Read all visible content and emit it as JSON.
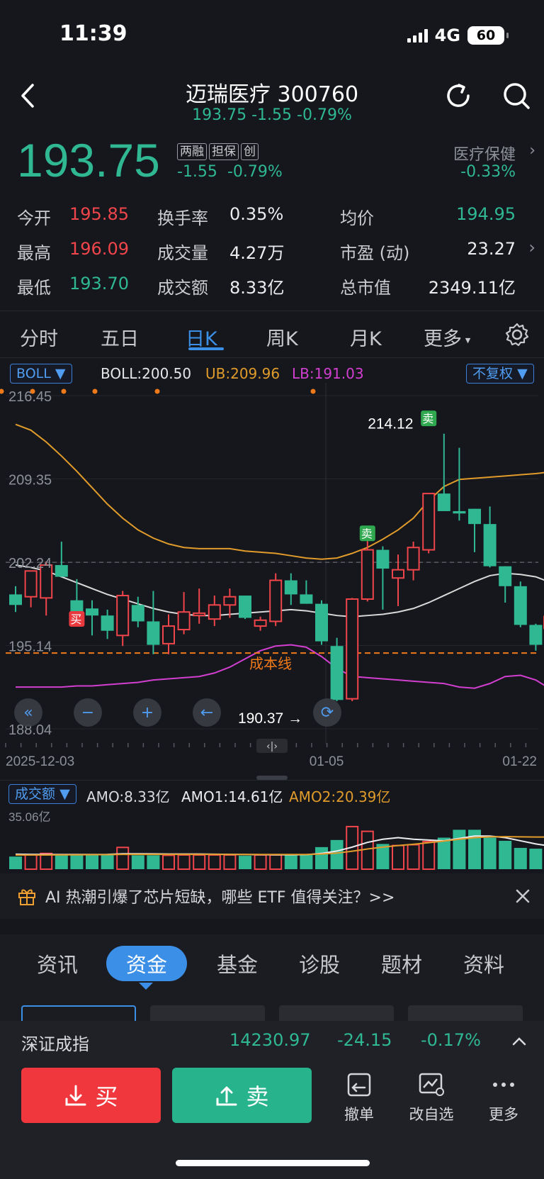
{
  "status": {
    "time": "11:39",
    "network": "4G",
    "battery": "60"
  },
  "header": {
    "title": "迈瑞医疗 300760",
    "subtitle": "193.75 -1.55 -0.79%"
  },
  "quote": {
    "price": "193.75",
    "tags": [
      "两融",
      "担保",
      "创"
    ],
    "change": "-1.55",
    "change_pct": "-0.79%",
    "sector_name": "医疗保健",
    "sector_change": "-0.33%"
  },
  "stats": {
    "open_label": "今开",
    "open": "195.85",
    "turnover_label": "换手率",
    "turnover": "0.35%",
    "avg_label": "均价",
    "avg": "194.95",
    "high_label": "最高",
    "high": "196.09",
    "volume_label": "成交量",
    "volume": "4.27万",
    "pe_label": "市盈 (动)",
    "pe": "23.27",
    "low_label": "最低",
    "low": "193.70",
    "amount_label": "成交额",
    "amount": "8.33亿",
    "mcap_label": "总市值",
    "mcap": "2349.11亿"
  },
  "period_tabs": [
    "分时",
    "五日",
    "日K",
    "周K",
    "月K",
    "更多"
  ],
  "active_period": "日K",
  "indicator": {
    "name": "BOLL",
    "boll": "BOLL:200.50",
    "ub": "UB:209.96",
    "lb": "LB:191.03",
    "adjust": "不复权"
  },
  "chart_data": {
    "type": "candlestick",
    "y_ticks": [
      "216.45",
      "209.35",
      "202.24",
      "195.14",
      "188.04"
    ],
    "ylim": [
      188.04,
      216.45
    ],
    "x_labels": [
      "2025-12-03",
      "01-05",
      "01-22"
    ],
    "annotations": {
      "high_label": "214.12",
      "low_label": "190.37",
      "cost_line_label": "成本线",
      "cost_line_value": 194.5,
      "sell_marker": "卖",
      "buy_marker": "买"
    },
    "candles": [
      {
        "o": 199.5,
        "h": 200.2,
        "l": 198.0,
        "c": 198.6
      },
      {
        "o": 199.3,
        "h": 201.3,
        "l": 198.4,
        "c": 201.5
      },
      {
        "o": 199.2,
        "h": 202.3,
        "l": 197.7,
        "c": 202.0
      },
      {
        "o": 202.0,
        "h": 204.0,
        "l": 201.1,
        "c": 201.0
      },
      {
        "o": 199.0,
        "h": 200.8,
        "l": 197.7,
        "c": 197.8
      },
      {
        "o": 198.3,
        "h": 199.0,
        "l": 196.0,
        "c": 197.7
      },
      {
        "o": 197.7,
        "h": 198.2,
        "l": 195.7,
        "c": 196.4
      },
      {
        "o": 196.0,
        "h": 199.8,
        "l": 195.1,
        "c": 199.4
      },
      {
        "o": 198.6,
        "h": 199.3,
        "l": 196.7,
        "c": 197.2
      },
      {
        "o": 197.2,
        "h": 199.8,
        "l": 194.4,
        "c": 195.2
      },
      {
        "o": 195.3,
        "h": 197.8,
        "l": 194.4,
        "c": 196.8
      },
      {
        "o": 196.5,
        "h": 199.7,
        "l": 196.1,
        "c": 198.0
      },
      {
        "o": 197.7,
        "h": 200.0,
        "l": 197.0,
        "c": 197.9
      },
      {
        "o": 197.4,
        "h": 199.4,
        "l": 196.8,
        "c": 198.6
      },
      {
        "o": 198.6,
        "h": 200.0,
        "l": 197.5,
        "c": 199.3
      },
      {
        "o": 199.4,
        "h": 199.4,
        "l": 197.4,
        "c": 197.5
      },
      {
        "o": 196.8,
        "h": 197.6,
        "l": 196.4,
        "c": 197.3
      },
      {
        "o": 197.2,
        "h": 201.3,
        "l": 196.8,
        "c": 200.7
      },
      {
        "o": 200.7,
        "h": 201.3,
        "l": 198.6,
        "c": 199.5
      },
      {
        "o": 199.5,
        "h": 200.7,
        "l": 198.7,
        "c": 198.7
      },
      {
        "o": 198.7,
        "h": 199.0,
        "l": 195.2,
        "c": 195.5
      },
      {
        "o": 195.1,
        "h": 195.8,
        "l": 190.4,
        "c": 190.5
      },
      {
        "o": 190.6,
        "h": 199.2,
        "l": 190.4,
        "c": 199.1
      },
      {
        "o": 199.1,
        "h": 204.3,
        "l": 198.9,
        "c": 203.3
      },
      {
        "o": 203.3,
        "h": 203.6,
        "l": 198.2,
        "c": 201.7
      },
      {
        "o": 200.9,
        "h": 202.9,
        "l": 198.5,
        "c": 201.6
      },
      {
        "o": 201.6,
        "h": 204.0,
        "l": 200.7,
        "c": 203.5
      },
      {
        "o": 203.3,
        "h": 208.0,
        "l": 203.0,
        "c": 208.1
      },
      {
        "o": 208.1,
        "h": 213.2,
        "l": 206.7,
        "c": 206.6
      },
      {
        "o": 206.6,
        "h": 212.0,
        "l": 205.8,
        "c": 206.4
      },
      {
        "o": 206.8,
        "h": 206.8,
        "l": 203.1,
        "c": 205.5
      },
      {
        "o": 205.5,
        "h": 207.0,
        "l": 201.8,
        "c": 201.9
      },
      {
        "o": 201.9,
        "h": 201.9,
        "l": 198.8,
        "c": 200.2
      },
      {
        "o": 200.2,
        "h": 200.6,
        "l": 196.7,
        "c": 196.9
      },
      {
        "o": 196.9,
        "h": 197.0,
        "l": 194.7,
        "c": 195.2
      },
      {
        "o": 195.2,
        "h": 195.7,
        "l": 193.7,
        "c": 193.8
      }
    ],
    "boll_ub": [
      214.0,
      213.5,
      212.5,
      211.3,
      210.0,
      208.6,
      207.2,
      206.0,
      205.0,
      204.3,
      203.8,
      203.5,
      203.4,
      203.4,
      203.4,
      203.2,
      203.1,
      203.0,
      202.8,
      202.6,
      202.5,
      202.6,
      203.0,
      203.5,
      204.2,
      205.0,
      206.0,
      207.5,
      208.7,
      209.3,
      209.4,
      209.5,
      209.6,
      209.7,
      209.8,
      209.96
    ],
    "boll_mid": [
      202.0,
      201.8,
      201.5,
      201.0,
      200.5,
      200.0,
      199.5,
      199.1,
      198.7,
      198.3,
      198.0,
      197.8,
      197.7,
      197.7,
      197.8,
      197.9,
      198.0,
      198.1,
      198.2,
      198.1,
      197.9,
      197.7,
      197.6,
      197.7,
      197.8,
      198.0,
      198.3,
      198.8,
      199.4,
      200.0,
      200.6,
      201.1,
      201.3,
      201.2,
      201.0,
      200.5
    ],
    "boll_lb": [
      191.6,
      191.6,
      191.6,
      191.6,
      191.7,
      191.7,
      191.8,
      191.9,
      192.0,
      192.2,
      192.3,
      192.4,
      192.5,
      192.8,
      193.3,
      194.0,
      194.7,
      195.1,
      195.2,
      195.0,
      194.2,
      193.2,
      192.5,
      192.4,
      192.3,
      192.2,
      192.1,
      192.0,
      191.9,
      191.6,
      191.5,
      191.9,
      192.5,
      192.6,
      192.2,
      191.4
    ],
    "sell_marks": [
      {
        "index": 23,
        "price": 203.8
      },
      {
        "index": 27,
        "price": 213.6
      }
    ],
    "buy_marks": [
      {
        "index": 4,
        "price": 196.5
      },
      {
        "index": 35,
        "price": 196.2
      }
    ]
  },
  "chart_nav": {
    "left_label": "190.37"
  },
  "volume": {
    "selector": "成交额",
    "amo": "AMO:8.33亿",
    "amo1": "AMO1:14.61亿",
    "amo2": "AMO2:20.39亿",
    "y_max_label": "35.06亿",
    "values": [
      8.0,
      9.0,
      10.0,
      9.5,
      9.0,
      9.3,
      9.0,
      13.8,
      8.8,
      8.8,
      8.8,
      9.0,
      9.0,
      9.0,
      9.0,
      8.5,
      9.0,
      9.0,
      9.0,
      9.5,
      14.0,
      18.5,
      27.0,
      24.0,
      16.0,
      15.0,
      15.5,
      17.5,
      20.0,
      25.0,
      25.0,
      20.0,
      18.0,
      13.5,
      13.0,
      8.33
    ],
    "ma1": [
      9.5,
      9.4,
      9.3,
      9.3,
      9.3,
      9.3,
      9.4,
      9.8,
      9.8,
      9.7,
      9.6,
      9.6,
      9.6,
      9.5,
      9.4,
      9.3,
      9.2,
      9.1,
      9.1,
      9.2,
      10.0,
      11.5,
      14.0,
      17.0,
      19.0,
      20.0,
      19.0,
      18.5,
      18.0,
      19.5,
      21.0,
      21.0,
      20.0,
      18.0,
      16.0,
      14.61
    ],
    "ma2": [
      9.0,
      9.0,
      9.0,
      9.1,
      9.1,
      9.2,
      9.2,
      9.4,
      9.4,
      9.4,
      9.4,
      9.4,
      9.4,
      9.4,
      9.3,
      9.3,
      9.3,
      9.3,
      9.3,
      9.3,
      9.6,
      10.2,
      11.4,
      12.8,
      14.0,
      15.0,
      15.8,
      16.8,
      17.8,
      19.0,
      20.0,
      20.5,
      20.6,
      20.5,
      20.4,
      20.39
    ],
    "ylim": [
      0,
      35.06
    ]
  },
  "banner": {
    "text": "AI 热潮引爆了芯片短缺，哪些 ETF 值得关注？>>"
  },
  "info_tabs": [
    "资讯",
    "资金",
    "基金",
    "诊股",
    "题材",
    "资料"
  ],
  "active_info_tab": "资金",
  "index_bar": {
    "name": "深证成指",
    "value": "14230.97",
    "change": "-24.15",
    "change_pct": "-0.17%"
  },
  "actions": {
    "buy": "买",
    "sell": "卖",
    "cancel": "撤单",
    "edit_watch": "改自选",
    "more": "更多"
  },
  "colors": {
    "up": "#f0454a",
    "down": "#2fb892",
    "ub": "#e09b2b",
    "mid": "#d9d9d9",
    "lb": "#d23fd0",
    "accent": "#3b8fe6"
  }
}
